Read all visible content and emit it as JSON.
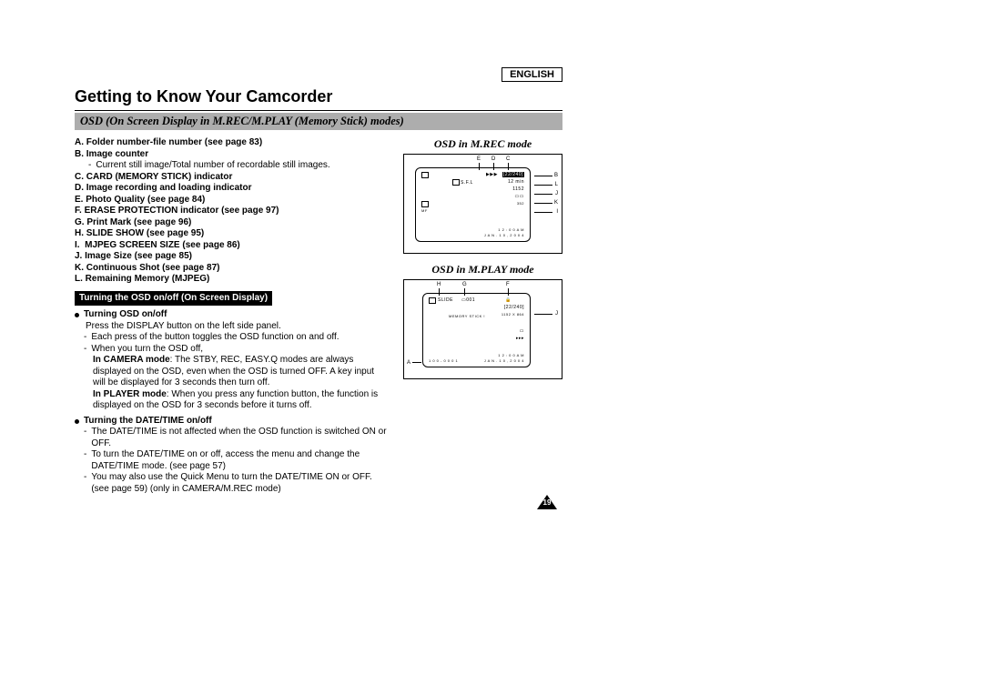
{
  "language": "ENGLISH",
  "title": "Getting to Know Your Camcorder",
  "band": "OSD (On Screen Display in M.REC/M.PLAY (Memory Stick) modes)",
  "items": {
    "A": "Folder number-file number (see page 83)",
    "B": "Image counter",
    "B_note": "Current still image/Total number of recordable still images.",
    "C": "CARD (MEMORY STICK) indicator",
    "D": "Image recording and loading indicator",
    "E": "Photo Quality (see page 84)",
    "F": "ERASE PROTECTION indicator (see page 97)",
    "G": "Print Mark (see page 96)",
    "H": "SLIDE SHOW (see page 95)",
    "I": "MJPEG SCREEN SIZE (see page 86)",
    "J": "Image Size (see page 85)",
    "K": "Continuous Shot (see page 87)",
    "L": "Remaining Memory (MJPEG)"
  },
  "blackbar": "Turning the OSD on/off (On Screen Display)",
  "osd_onoff": {
    "head": "Turning OSD on/off",
    "l1": "Press the DISPLAY button on the left side panel.",
    "l2": "Each press of the button toggles the OSD function on and off.",
    "l3": "When you turn the OSD off,",
    "cam_head": "In CAMERA mode",
    "cam": ": The STBY, REC, EASY.Q modes are always displayed on the OSD, even when the OSD is turned OFF. A key input will be displayed for 3 seconds then turn off.",
    "play_head": "In PLAYER mode",
    "play": ": When you press any function button, the function is displayed on the OSD for 3 seconds before it turns off."
  },
  "dt": {
    "head": "Turning the DATE/TIME on/off",
    "l1": "The DATE/TIME is not affected when the OSD function is switched ON or OFF.",
    "l2": "To turn the DATE/TIME on or off, access the menu and change the DATE/TIME mode. (see page 57)",
    "l3": "You may also use the Quick Menu to turn the DATE/TIME ON or OFF. (see page 59) (only in CAMERA/M.REC mode)"
  },
  "panels": {
    "mrec_title": "OSD in M.REC mode",
    "mplay_title": "OSD in M.PLAY mode"
  },
  "mrec": {
    "counter": "[22/240]",
    "sfl": "S.F.L",
    "size": "1152",
    "min": "12 min",
    "nf": "N.F",
    "time": "1 2 : 0 0 A M",
    "date": "J A N . 1 0 , 2 0 0 4"
  },
  "mplay": {
    "slide": "SLIDE",
    "stick": "MEMORY STICK !",
    "counter": "[22/240]",
    "size": "1152 X 864",
    "file": "1 0 0 - 0 0 0 1",
    "time": "1 2 : 0 0 A M",
    "date": "J A N . 1 0 , 2 0 0 4"
  },
  "labels": {
    "A": "A",
    "B": "B",
    "C": "C",
    "D": "D",
    "E": "E",
    "F": "F",
    "G": "G",
    "H": "H",
    "I": "I",
    "J": "J",
    "K": "K",
    "L": "L"
  },
  "pagenum": "19"
}
